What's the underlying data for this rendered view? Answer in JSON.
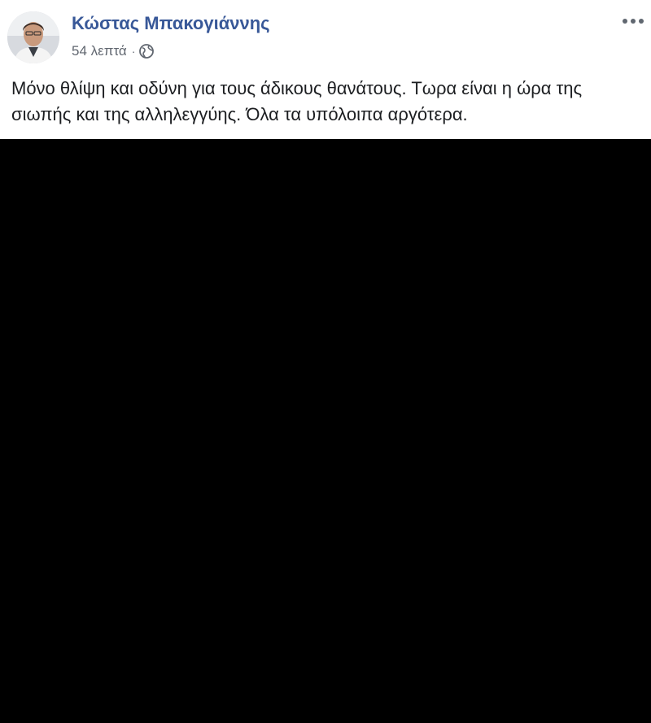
{
  "post": {
    "author": {
      "name": "Κώστας Μπακογιάννης",
      "avatar_icon": "profile-photo"
    },
    "timestamp": "54 λεπτά",
    "separator": "·",
    "privacy_icon": "globe-icon",
    "more_icon": "more-options-icon",
    "text": "Μόνο θλίψη και οδύνη για τους άδικους θανάτους. Τωρα είναι η ώρα της σιωπής και της αλληλεγγύης. Όλα τα υπόλοιπα αργότερα.",
    "media": {
      "background_color": "#000000"
    }
  },
  "colors": {
    "author_link": "#385898",
    "meta_text": "#616770",
    "body_text": "#1c1e21"
  }
}
